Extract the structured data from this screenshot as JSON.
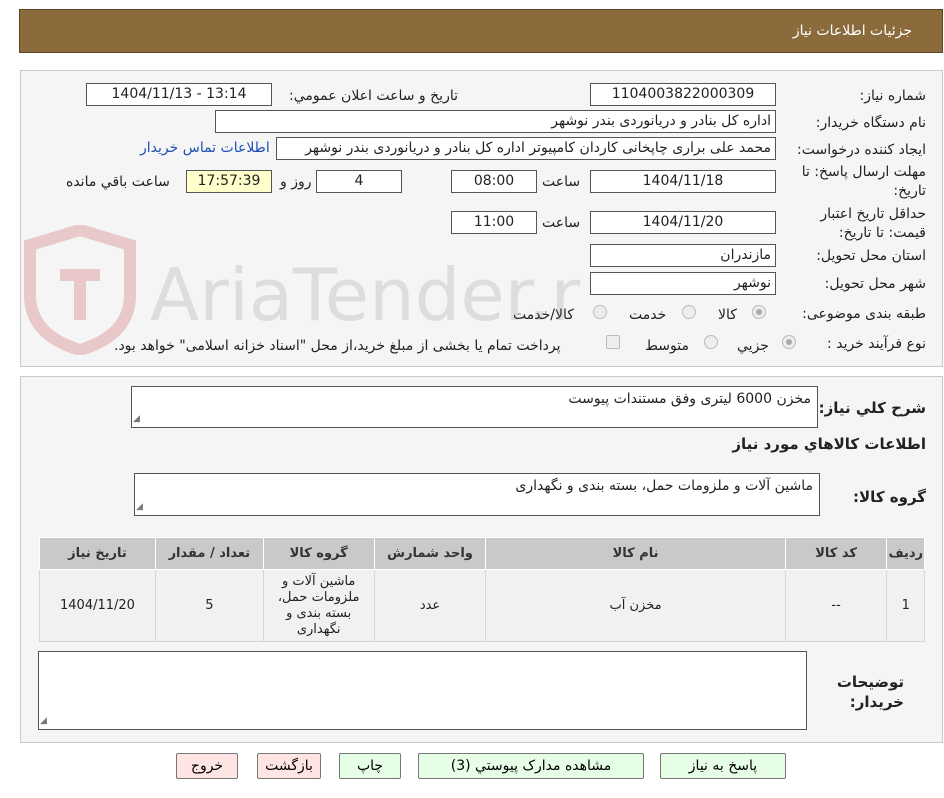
{
  "header": {
    "title": "جزئیات اطلاعات نیاز"
  },
  "form": {
    "need_number": {
      "label": "شماره نیاز:",
      "value": "1104003822000309"
    },
    "announce_datetime": {
      "label": "تاریخ و ساعت اعلان عمومي:",
      "value": "1404/11/13 - 13:14"
    },
    "buyer_org": {
      "label": "نام دستگاه خریدار:",
      "value": "اداره کل بنادر و دریانوردی بندر نوشهر"
    },
    "requester": {
      "label": "ایجاد کننده درخواست:",
      "value": "محمد علی براری چاپخانی کاردان کامپیوتر اداره کل بنادر و دریانوردی بندر نوشهر"
    },
    "contact_link": "اطلاعات تماس خریدار",
    "reply_deadline": {
      "label": "مهلت ارسال پاسخ: تا تاریخ:",
      "date": "1404/11/18",
      "time_label": "ساعت",
      "time": "08:00",
      "days": "4",
      "days_label": "روز و",
      "remaining": "17:57:39",
      "remaining_label": "ساعت باقي مانده"
    },
    "price_validity": {
      "label": "حداقل تاریخ اعتبار قیمت: تا تاریخ:",
      "date": "1404/11/20",
      "time_label": "ساعت",
      "time": "11:00"
    },
    "province": {
      "label": "استان محل تحویل:",
      "value": "مازندران"
    },
    "city": {
      "label": "شهر محل تحویل:",
      "value": "نوشهر"
    },
    "category": {
      "label": "طبقه بندی موضوعی:",
      "options": [
        "کالا",
        "خدمت",
        "کالا/خدمت"
      ]
    },
    "process": {
      "label": "نوع فرآیند خرید :",
      "options": [
        "جزیي",
        "متوسط"
      ],
      "payment_note": "پرداخت تمام یا بخشی از مبلغ خرید،از محل \"اسناد خزانه اسلامی\" خواهد بود."
    }
  },
  "summary": {
    "label": "شرح کلي نیاز:",
    "value": "مخزن 6000 لیتری وفق مستندات پیوست",
    "items_title": "اطلاعات کالاهاي مورد نیاز",
    "group_label": "گروه کالا:",
    "group_value": "ماشین آلات و ملزومات حمل، بسته بندی و نگهداری"
  },
  "table": {
    "headers": [
      "ردیف",
      "کد کالا",
      "نام کالا",
      "واحد شمارش",
      "گروه کالا",
      "تعداد / مقدار",
      "تاریخ نیاز"
    ],
    "rows": [
      [
        "1",
        "--",
        "مخزن آب",
        "عدد",
        "ماشین آلات و ملزومات حمل، بسته بندی و نگهداری",
        "5",
        "1404/11/20"
      ]
    ]
  },
  "buyer_notes": {
    "label": "توضیحات خریدار:",
    "value": ""
  },
  "buttons": {
    "reply": "پاسخ به نیاز",
    "attachments": "مشاهده مدارک پیوستي (3)",
    "print": "چاپ",
    "back": "بازگشت",
    "exit": "خروج"
  },
  "watermark": "AriaTender.neT"
}
